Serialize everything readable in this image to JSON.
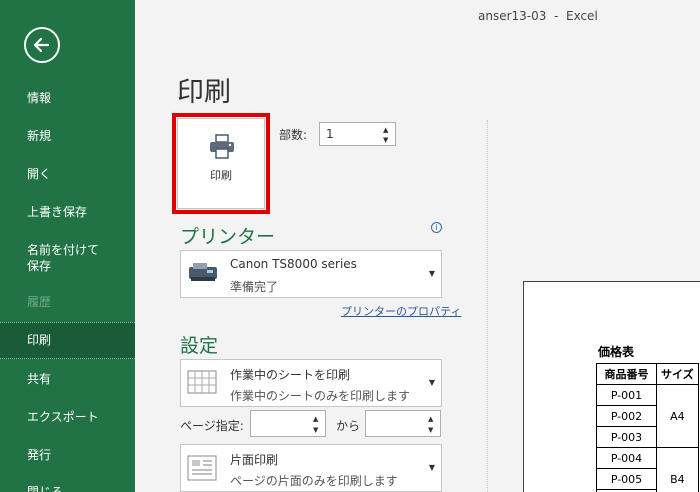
{
  "window": {
    "title": "anser13-03  -  Excel"
  },
  "sidebar": {
    "items": [
      {
        "label": "情報"
      },
      {
        "label": "新規"
      },
      {
        "label": "開く"
      },
      {
        "label": "上書き保存"
      },
      {
        "label": "名前を付けて",
        "label2": "保存"
      },
      {
        "label": "履歴"
      },
      {
        "label": "印刷"
      },
      {
        "label": "共有"
      },
      {
        "label": "エクスポート"
      },
      {
        "label": "発行"
      },
      {
        "label": "閉じる"
      }
    ]
  },
  "main": {
    "title": "印刷",
    "print_button_label": "印刷",
    "copies_label": "部数:",
    "copies_value": "1",
    "printer_section": "プリンター",
    "printer": {
      "name": "Canon TS8000 series",
      "status": "準備完了"
    },
    "printer_properties": "プリンターのプロパティ",
    "settings_section": "設定",
    "print_what": {
      "main": "作業中のシートを印刷",
      "sub": "作業中のシートのみを印刷します"
    },
    "pages_label": "ページ指定:",
    "to_label": "から",
    "sides": {
      "main": "片面印刷",
      "sub": "ページの片面のみを印刷します"
    }
  },
  "preview": {
    "title": "価格表",
    "headers": [
      "商品番号",
      "サイズ"
    ],
    "rows": [
      {
        "code": "P-001"
      },
      {
        "code": "P-002",
        "size": "A4"
      },
      {
        "code": "P-003"
      },
      {
        "code": "P-004"
      },
      {
        "code": "P-005",
        "size": "B4"
      }
    ]
  },
  "colors": {
    "accent": "#217346",
    "highlight": "#e00000",
    "link": "#2b5797"
  }
}
